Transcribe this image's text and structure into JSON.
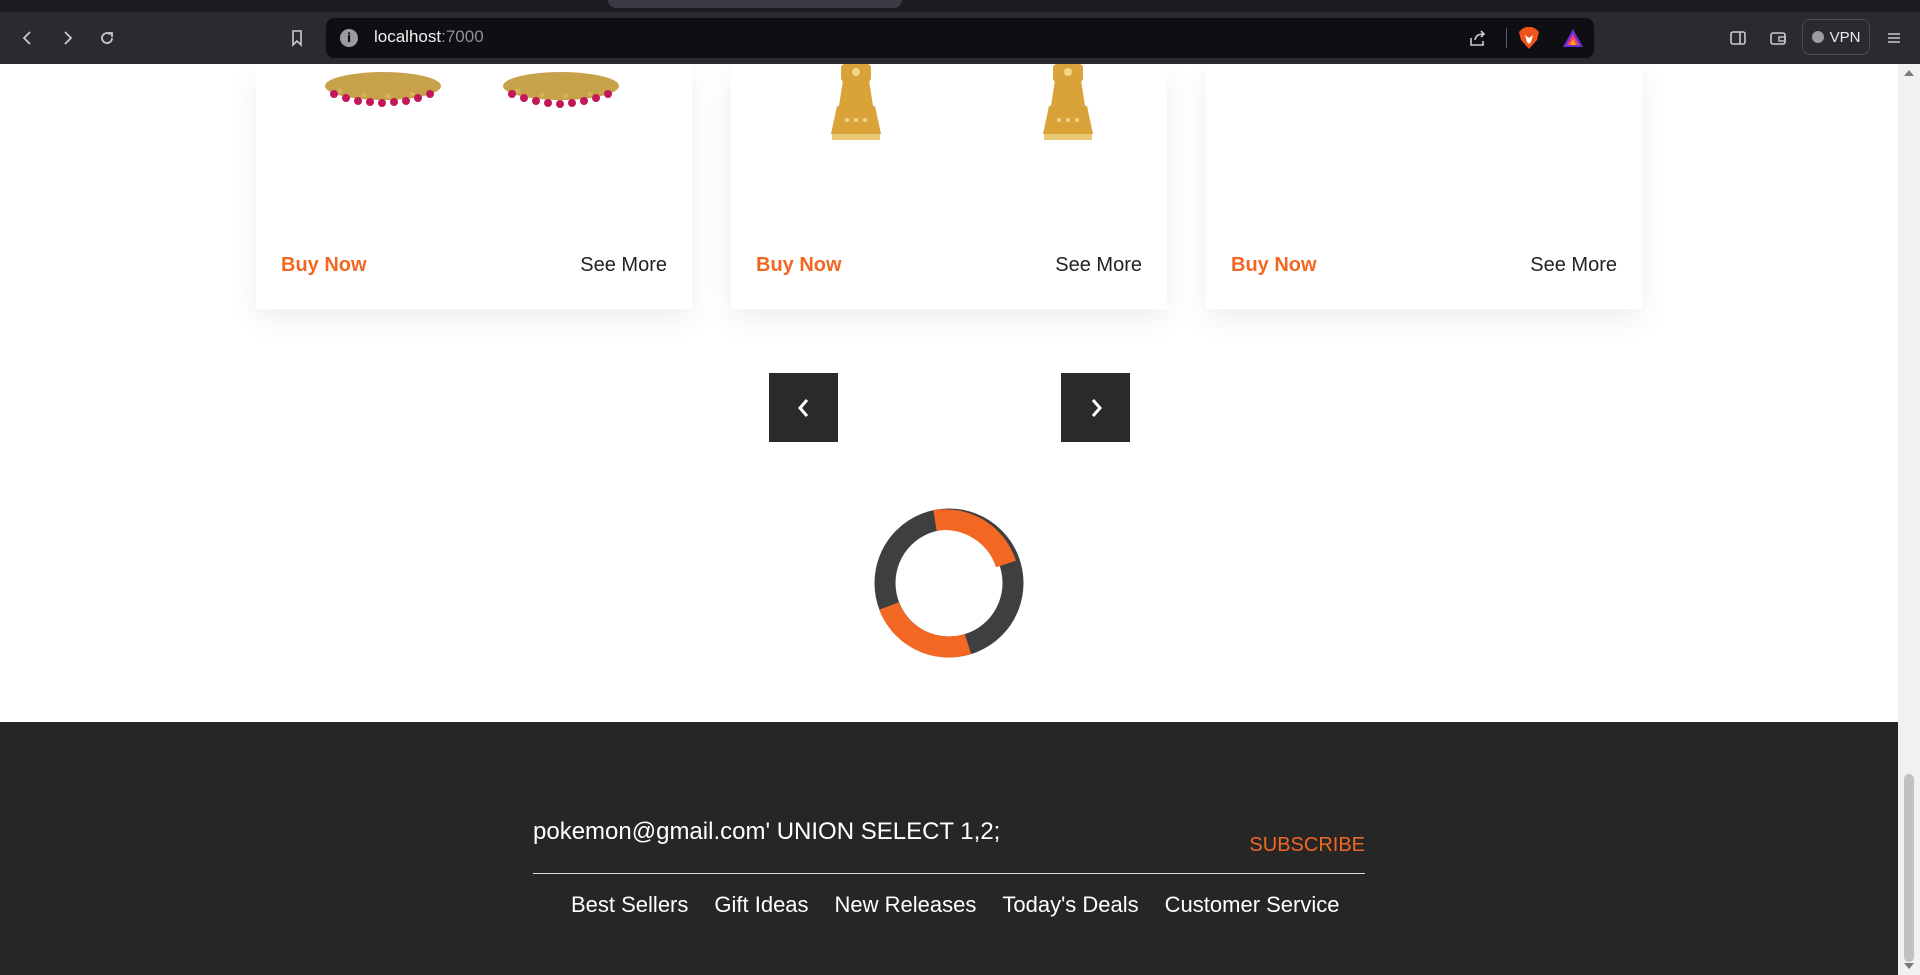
{
  "browser": {
    "url_host": "localhost",
    "url_port": ":7000",
    "vpn_label": "VPN",
    "icons": [
      "back-icon",
      "forward-icon",
      "reload-icon",
      "bookmark-icon",
      "site-info-icon",
      "share-icon",
      "brave-shields-icon",
      "brave-rewards-icon",
      "sidebar-icon",
      "wallet-icon",
      "menu-icon"
    ]
  },
  "products": [
    {
      "buy_label": "Buy Now",
      "more_label": "See More",
      "image": "red-gold-jhumka-earrings"
    },
    {
      "buy_label": "Buy Now",
      "more_label": "See More",
      "image": "gold-temple-earrings"
    },
    {
      "buy_label": "Buy Now",
      "more_label": "See More",
      "image": "empty"
    }
  ],
  "carousel": {
    "prev_icon": "chevron-left-icon",
    "next_icon": "chevron-right-icon"
  },
  "loader": {
    "colors": {
      "accent": "#f26722",
      "dark": "#3d3f40"
    }
  },
  "footer": {
    "email_value": "pokemon@gmail.com' UNION SELECT 1,2;",
    "subscribe_label": "SUBSCRIBE",
    "links": [
      "Best Sellers",
      "Gift Ideas",
      "New Releases",
      "Today's Deals",
      "Customer Service"
    ]
  },
  "colors": {
    "accent": "#f26722",
    "footer_bg": "#262626"
  }
}
